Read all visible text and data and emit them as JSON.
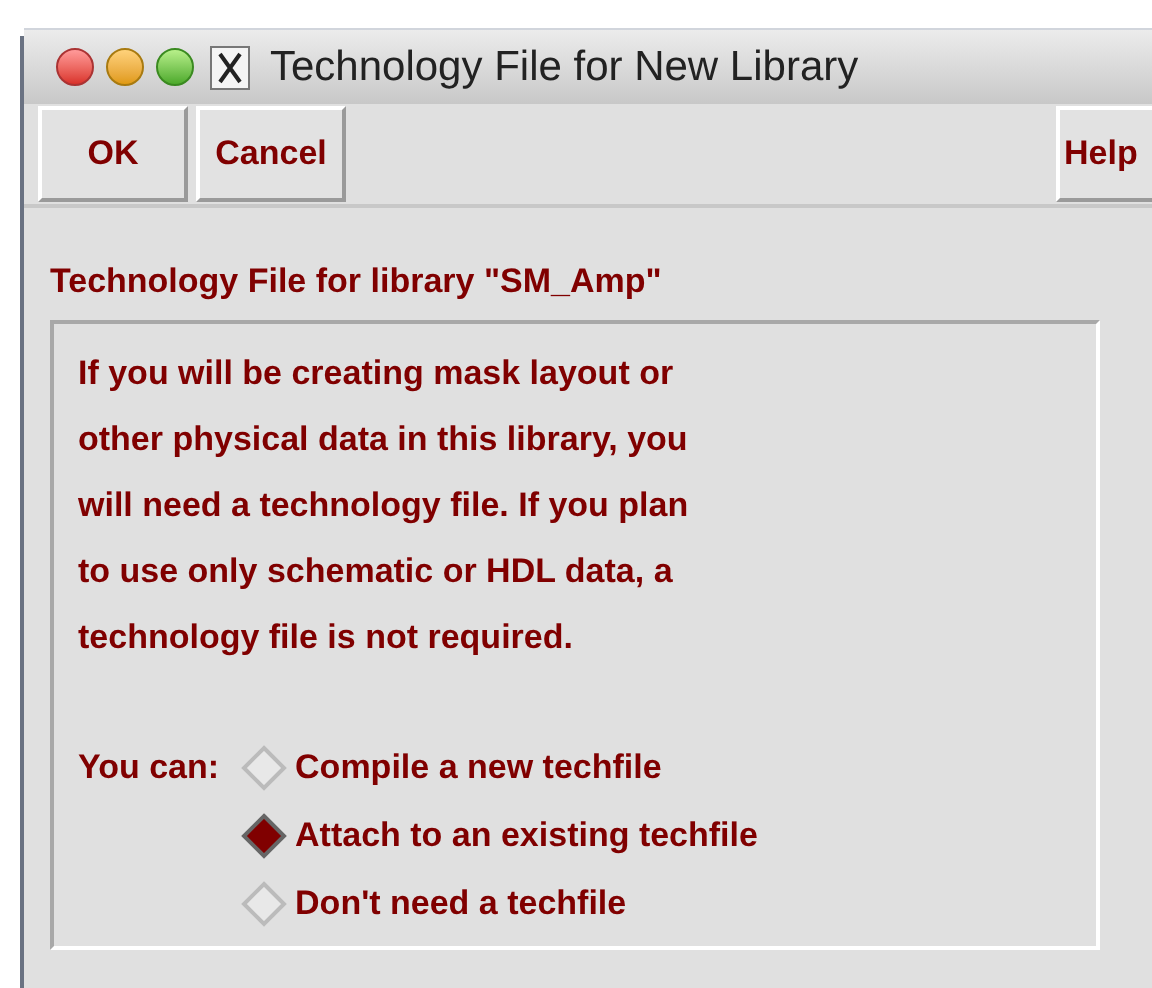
{
  "window": {
    "title": "Technology File for New Library"
  },
  "toolbar": {
    "buttons": [
      "OK",
      "Cancel"
    ],
    "help": "Help"
  },
  "section_label": "Technology File for library \"SM_Amp\"",
  "description": [
    "If you will be creating mask layout or",
    "other physical data in this library, you",
    "will need a technology file. If you plan",
    "to use only schematic or HDL data, a",
    "technology file is not required."
  ],
  "options": {
    "label": "You can:",
    "items": [
      {
        "label": "Compile a new techfile",
        "selected": false
      },
      {
        "label": "Attach to an existing techfile",
        "selected": true
      },
      {
        "label": "Don't need a techfile",
        "selected": false
      }
    ]
  }
}
